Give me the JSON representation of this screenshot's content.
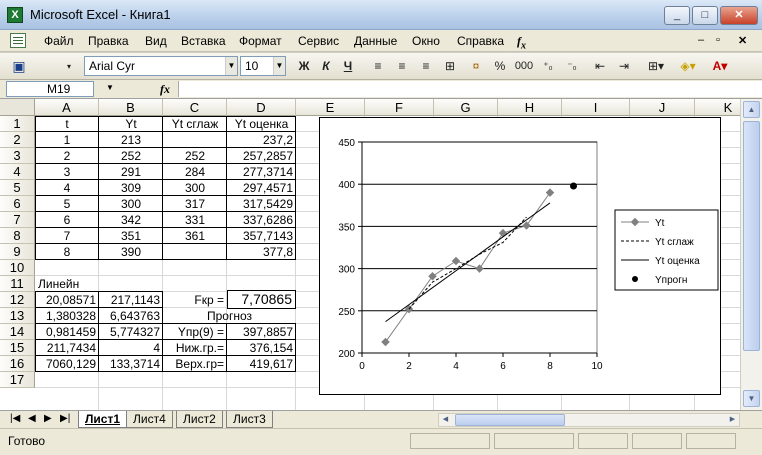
{
  "window": {
    "title": "Microsoft Excel - Книга1",
    "min": "_",
    "max": "□",
    "close": "✕"
  },
  "menu": [
    "Файл",
    "Правка",
    "Вид",
    "Вставка",
    "Формат",
    "Сервис",
    "Данные",
    "Окно",
    "Справка"
  ],
  "toolbar": {
    "font": "Arial Cyr",
    "size": "10",
    "bold": "Ж",
    "italic": "К",
    "underline": "Ч",
    "percent": "%",
    "thousands": "000"
  },
  "formula": {
    "cell_ref": "M19",
    "fx": "fx",
    "value": ""
  },
  "columns": [
    "A",
    "B",
    "C",
    "D",
    "E",
    "F",
    "G",
    "H",
    "I",
    "J",
    "K"
  ],
  "rows": [
    "1",
    "2",
    "3",
    "4",
    "5",
    "6",
    "7",
    "8",
    "9",
    "10",
    "11",
    "12",
    "13",
    "14",
    "15",
    "16",
    "17"
  ],
  "header_row": {
    "t": "t",
    "yt": "Yt",
    "yt_smooth": "Yt сглаж",
    "yt_est": "Yt оценка"
  },
  "data_rows": [
    {
      "t": "1",
      "yt": "213",
      "sm": "",
      "est": "237,2"
    },
    {
      "t": "2",
      "yt": "252",
      "sm": "252",
      "est": "257,2857"
    },
    {
      "t": "3",
      "yt": "291",
      "sm": "284",
      "est": "277,3714"
    },
    {
      "t": "4",
      "yt": "309",
      "sm": "300",
      "est": "297,4571"
    },
    {
      "t": "5",
      "yt": "300",
      "sm": "317",
      "est": "317,5429"
    },
    {
      "t": "6",
      "yt": "342",
      "sm": "331",
      "est": "337,6286"
    },
    {
      "t": "7",
      "yt": "351",
      "sm": "361",
      "est": "357,7143"
    },
    {
      "t": "8",
      "yt": "390",
      "sm": "",
      "est": "377,8"
    }
  ],
  "linest": {
    "label": "Линейн",
    "rows": [
      [
        "20,08571",
        "217,1143"
      ],
      [
        "1,380328",
        "6,643763"
      ],
      [
        "0,981459",
        "5,774327"
      ],
      [
        "211,7434",
        "4"
      ],
      [
        "7060,129",
        "133,3714"
      ]
    ]
  },
  "stats": {
    "fkr_label": "Fкр =",
    "fkr_value": "7,70865",
    "forecast_label": "Прогноз",
    "ypr_label": "Yпр(9) =",
    "ypr_value": "397,8857",
    "low_label": "Ниж.гр.=",
    "low_value": "376,154",
    "high_label": "Верх.гр=",
    "high_value": "419,617"
  },
  "chart_data": {
    "type": "line",
    "x": [
      1,
      2,
      3,
      4,
      5,
      6,
      7,
      8
    ],
    "series": [
      {
        "name": "Yt",
        "values": [
          213,
          252,
          291,
          309,
          300,
          342,
          351,
          390
        ],
        "style": "solid-marker",
        "color": "#808080"
      },
      {
        "name": "Yt сглаж",
        "x": [
          2,
          3,
          4,
          5,
          6,
          7
        ],
        "values": [
          252,
          284,
          300,
          317,
          331,
          361
        ],
        "style": "dashed",
        "color": "#000000"
      },
      {
        "name": "Yt оценка",
        "values": [
          237.2,
          257.2857,
          277.3714,
          297.4571,
          317.5429,
          337.6286,
          357.7143,
          377.8
        ],
        "style": "solid",
        "color": "#000000"
      },
      {
        "name": "Yпрогн",
        "x": [
          9
        ],
        "values": [
          397.8857
        ],
        "style": "marker",
        "color": "#000000"
      }
    ],
    "xlim": [
      0,
      10
    ],
    "ylim": [
      200,
      450
    ],
    "xticks": [
      "0",
      "2",
      "4",
      "6",
      "8",
      "10"
    ],
    "yticks": [
      "200",
      "250",
      "300",
      "350",
      "400",
      "450"
    ],
    "grid": "horizontal",
    "legend": "right"
  },
  "tabs": [
    "Лист1",
    "Лист4",
    "Лист2",
    "Лист3"
  ],
  "status": "Готово"
}
